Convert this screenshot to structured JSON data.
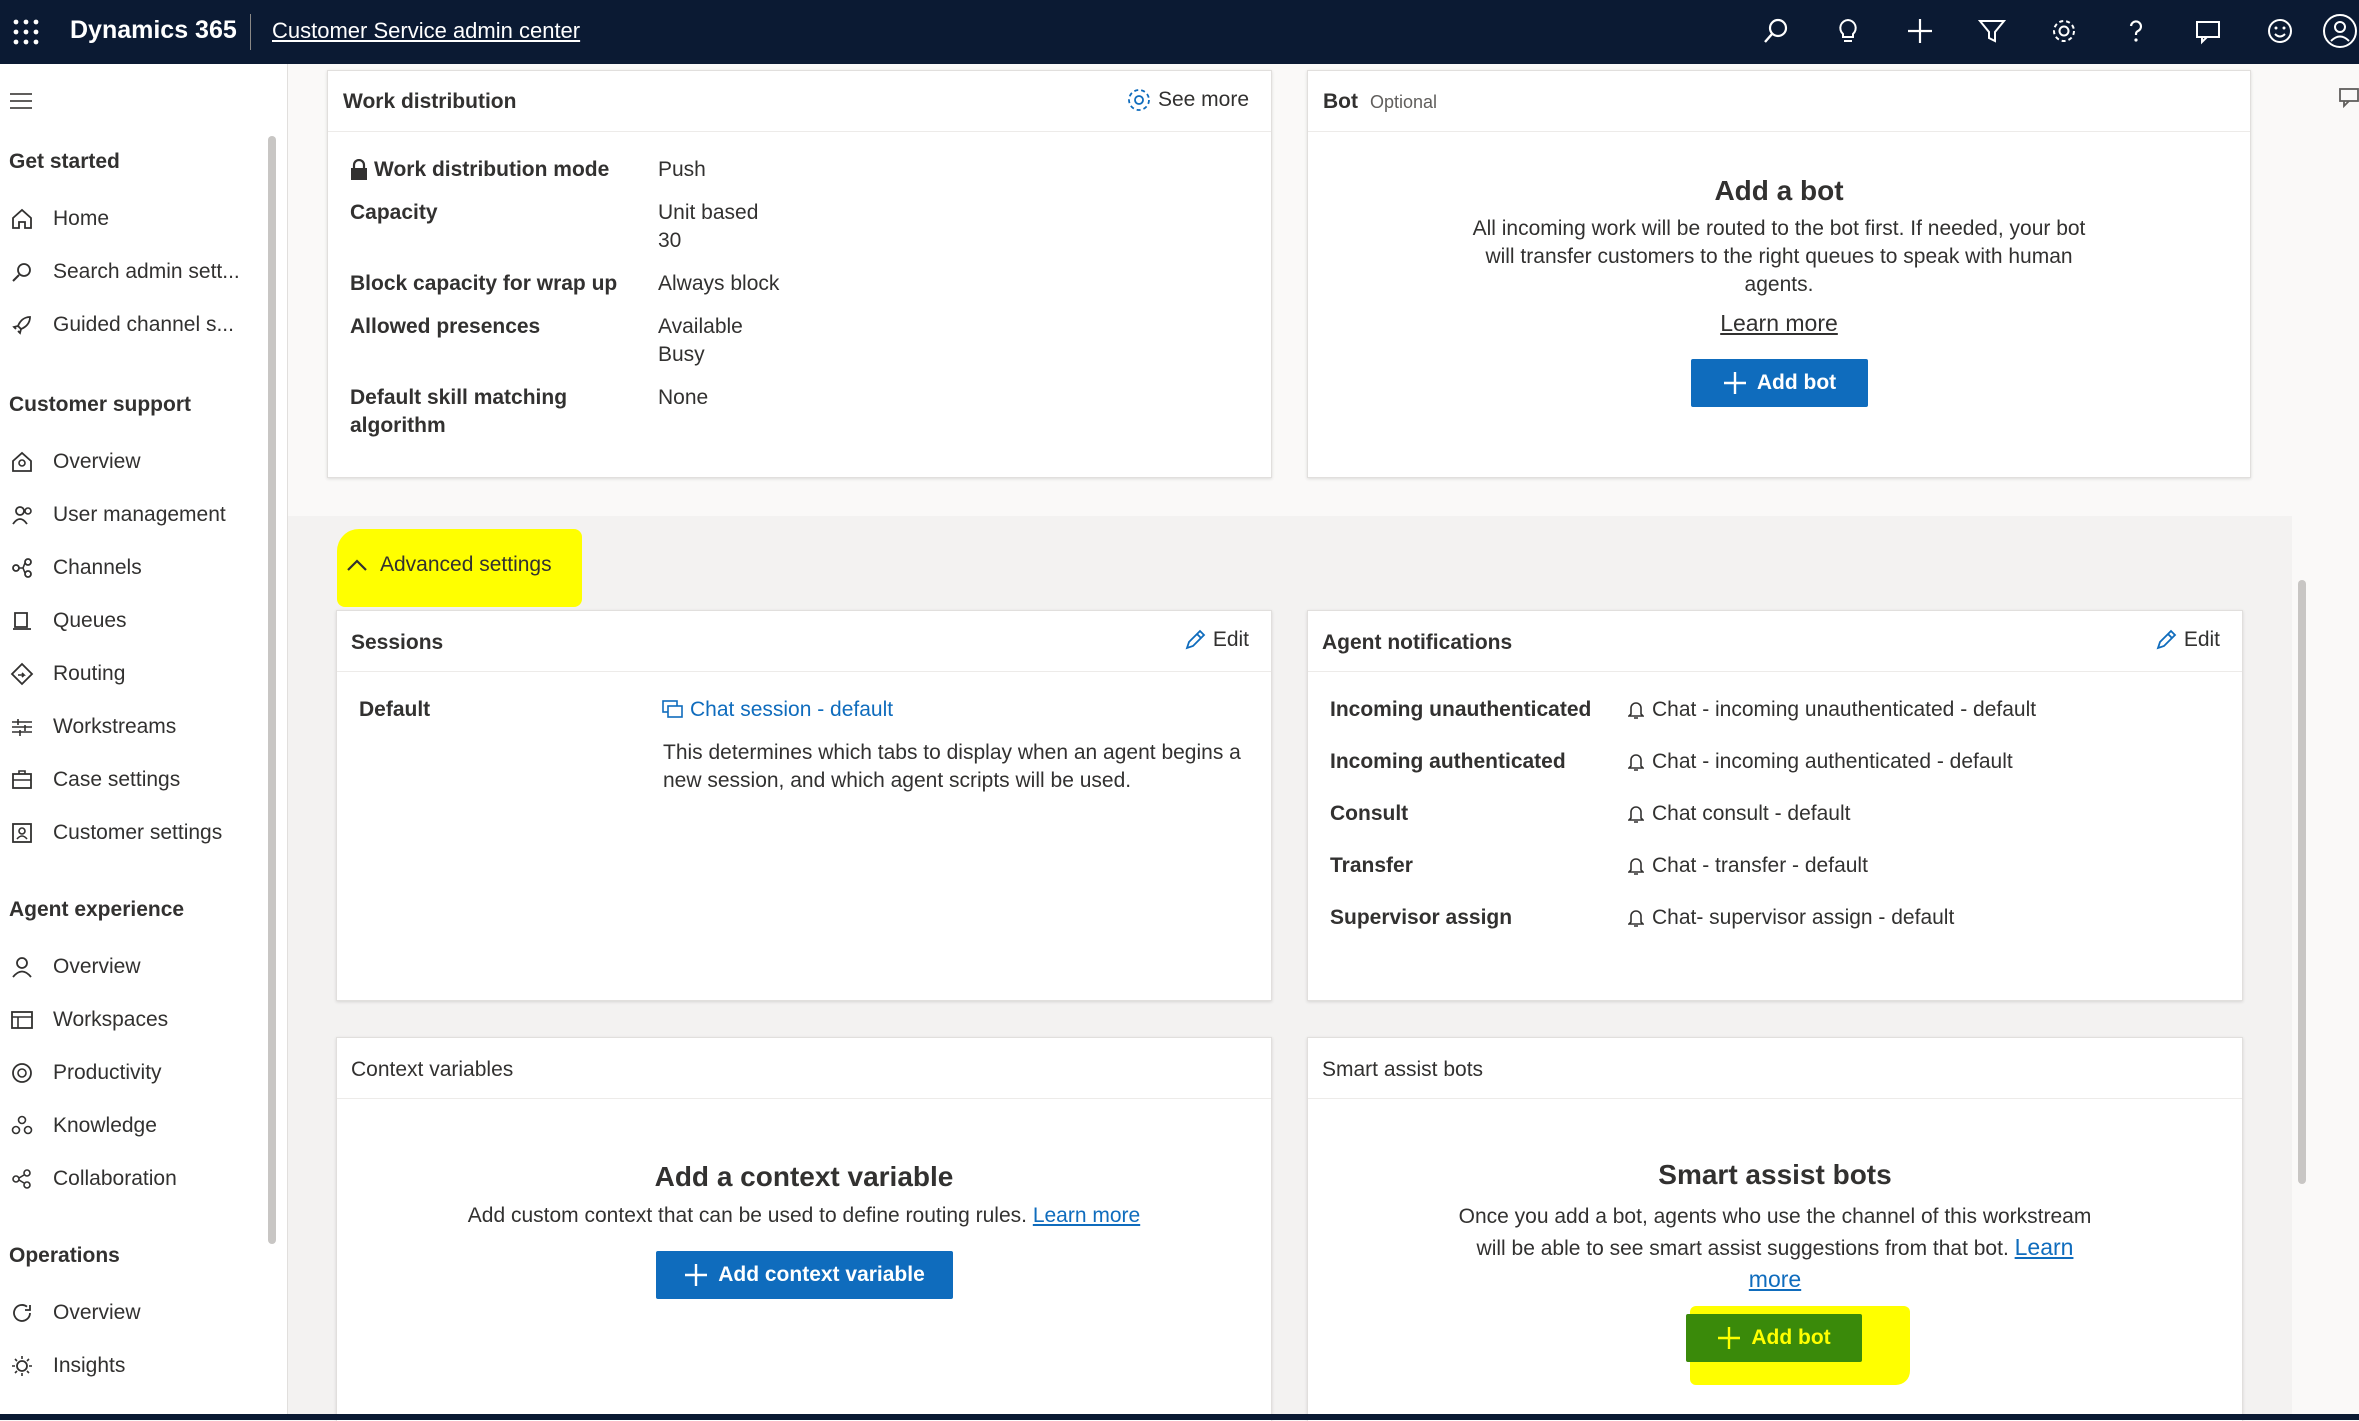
{
  "topbar": {
    "brand": "Dynamics 365",
    "app_name": "Customer Service admin center",
    "icons": [
      "search-icon",
      "lightbulb-icon",
      "plus-icon",
      "filter-icon",
      "gear-icon",
      "help-icon",
      "chat-icon",
      "smiley-icon",
      "avatar-icon"
    ]
  },
  "sidebar": {
    "sections": [
      {
        "title": "Get started",
        "items": [
          {
            "label": "Home",
            "icon": "home-icon"
          },
          {
            "label": "Search admin sett...",
            "icon": "search-icon"
          },
          {
            "label": "Guided channel s...",
            "icon": "rocket-icon"
          }
        ]
      },
      {
        "title": "Customer support",
        "items": [
          {
            "label": "Overview",
            "icon": "overview-icon"
          },
          {
            "label": "User management",
            "icon": "users-icon"
          },
          {
            "label": "Channels",
            "icon": "channels-icon"
          },
          {
            "label": "Queues",
            "icon": "queue-icon"
          },
          {
            "label": "Routing",
            "icon": "routing-icon"
          },
          {
            "label": "Workstreams",
            "icon": "workstreams-icon"
          },
          {
            "label": "Case settings",
            "icon": "case-icon"
          },
          {
            "label": "Customer settings",
            "icon": "customer-icon"
          }
        ]
      },
      {
        "title": "Agent experience",
        "items": [
          {
            "label": "Overview",
            "icon": "person-icon"
          },
          {
            "label": "Workspaces",
            "icon": "workspaces-icon"
          },
          {
            "label": "Productivity",
            "icon": "productivity-icon"
          },
          {
            "label": "Knowledge",
            "icon": "knowledge-icon"
          },
          {
            "label": "Collaboration",
            "icon": "collaboration-icon"
          }
        ]
      },
      {
        "title": "Operations",
        "items": [
          {
            "label": "Overview",
            "icon": "refresh-icon"
          },
          {
            "label": "Insights",
            "icon": "insights-icon"
          }
        ]
      }
    ]
  },
  "work_distribution": {
    "title": "Work distribution",
    "see_more": "See more",
    "rows": [
      {
        "label": "Work distribution mode",
        "value": "Push"
      },
      {
        "label": "Capacity",
        "value": "Unit based\n30"
      },
      {
        "label": "Block capacity for wrap up",
        "value": "Always block"
      },
      {
        "label": "Allowed presences",
        "value": "Available\nBusy"
      },
      {
        "label": "Default skill matching\nalgorithm",
        "value": "None"
      }
    ]
  },
  "bot_card": {
    "title": "Bot",
    "optional": "Optional",
    "empty_title": "Add a bot",
    "empty_desc": "All incoming work will be routed to the bot first. If needed, your bot will transfer customers to the right queues to speak with human agents.",
    "learn_more": "Learn more",
    "button": "Add bot"
  },
  "advanced": {
    "label": "Advanced settings",
    "highlight_color": "#ffff00"
  },
  "sessions": {
    "title": "Sessions",
    "edit": "Edit",
    "default_label": "Default",
    "session_link": "Chat session - default",
    "session_desc": "This determines which tabs to display when an agent begins a new session, and which agent scripts will be used."
  },
  "agent_notifications": {
    "title": "Agent notifications",
    "edit": "Edit",
    "rows": [
      {
        "label": "Incoming unauthenticated",
        "value": "Chat - incoming unauthenticated - default"
      },
      {
        "label": "Incoming authenticated",
        "value": "Chat - incoming authenticated - default"
      },
      {
        "label": "Consult",
        "value": "Chat consult - default"
      },
      {
        "label": "Transfer",
        "value": "Chat - transfer - default"
      },
      {
        "label": "Supervisor assign",
        "value": "Chat- supervisor assign - default"
      }
    ]
  },
  "context_variables": {
    "title": "Context variables",
    "empty_title": "Add a context variable",
    "empty_desc": "Add custom context that can be used to define routing rules.",
    "learn_more": "Learn more",
    "button": "Add context variable"
  },
  "smart_assist": {
    "title": "Smart assist bots",
    "empty_title": "Smart assist bots",
    "empty_desc": "Once you add a bot, agents who use the channel of this workstream will be able to see smart assist suggestions from that bot.",
    "learn_more": "Learn more",
    "button": "Add bot"
  },
  "colors": {
    "topbar": "#0b1a33",
    "primary": "#0f6cbd",
    "highlight": "#ffff00",
    "highlight_button_bg": "#3a8a0a"
  }
}
